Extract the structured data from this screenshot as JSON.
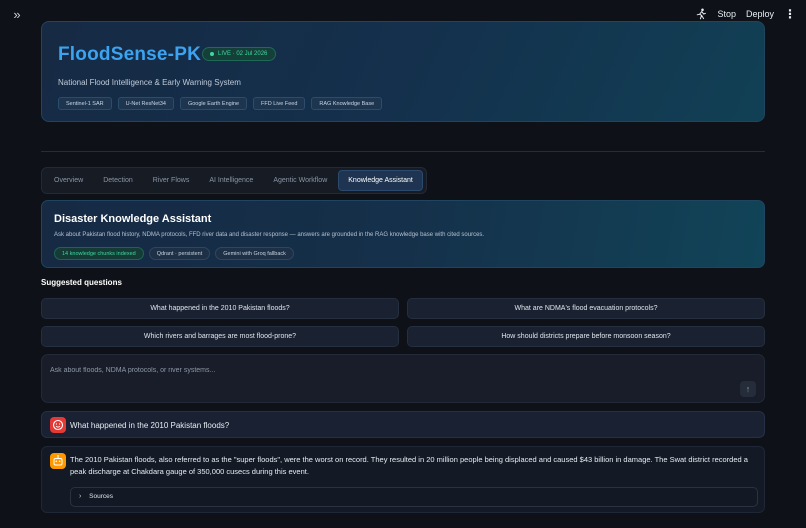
{
  "topbar": {
    "stop_label": "Stop",
    "deploy_label": "Deploy",
    "menu_icon": "vertical-dots-icon",
    "expand_icon": "double-chevron-right-icon"
  },
  "hero": {
    "title": "FloodSense-PK",
    "live_badge": "LIVE · 02 Jul 2026",
    "subtitle": "National Flood Intelligence & Early Warning System",
    "tags": [
      "Sentinel-1 SAR",
      "U-Net ResNet34",
      "Google Earth Engine",
      "FFD Live Feed",
      "RAG Knowledge Base"
    ]
  },
  "tabs": [
    {
      "label": "Overview",
      "active": false
    },
    {
      "label": "Detection",
      "active": false
    },
    {
      "label": "River Flows",
      "active": false
    },
    {
      "label": "AI Intelligence",
      "active": false
    },
    {
      "label": "Agentic Workflow",
      "active": false
    },
    {
      "label": "Knowledge Assistant",
      "active": true
    }
  ],
  "knowledge": {
    "title": "Disaster Knowledge Assistant",
    "description": "Ask about Pakistan flood history, NDMA protocols, FFD river data and disaster response — answers are grounded in the RAG knowledge base with cited sources.",
    "badges": [
      "14 knowledge chunks indexed",
      "Qdrant · persistent",
      "Gemini with Groq fallback"
    ]
  },
  "suggested": {
    "heading": "Suggested questions",
    "questions": [
      "What happened in the 2010 Pakistan floods?",
      "What are NDMA's flood evacuation protocols?",
      "Which rivers and barrages are most flood-prone?",
      "How should districts prepare before monsoon season?"
    ]
  },
  "chat": {
    "placeholder": "Ask about floods, NDMA protocols, or river systems...",
    "send_icon": "arrow-up-icon",
    "user_message": "What happened in the 2010 Pakistan floods?",
    "assistant_message": "The 2010 Pakistan floods, also referred to as the \"super floods\", were the worst on record. They resulted in 20 million people being displaced and caused $43 billion in damage. The Swat district recorded a peak discharge at Chakdara gauge of 350,000 cusecs during this event.",
    "sources_label": "Sources"
  },
  "colors": {
    "background": "#0e1117",
    "accent": "#3ba3f0",
    "live": "#3fd79b",
    "user_avatar": "#e53935",
    "bot_avatar": "#ff9800"
  }
}
